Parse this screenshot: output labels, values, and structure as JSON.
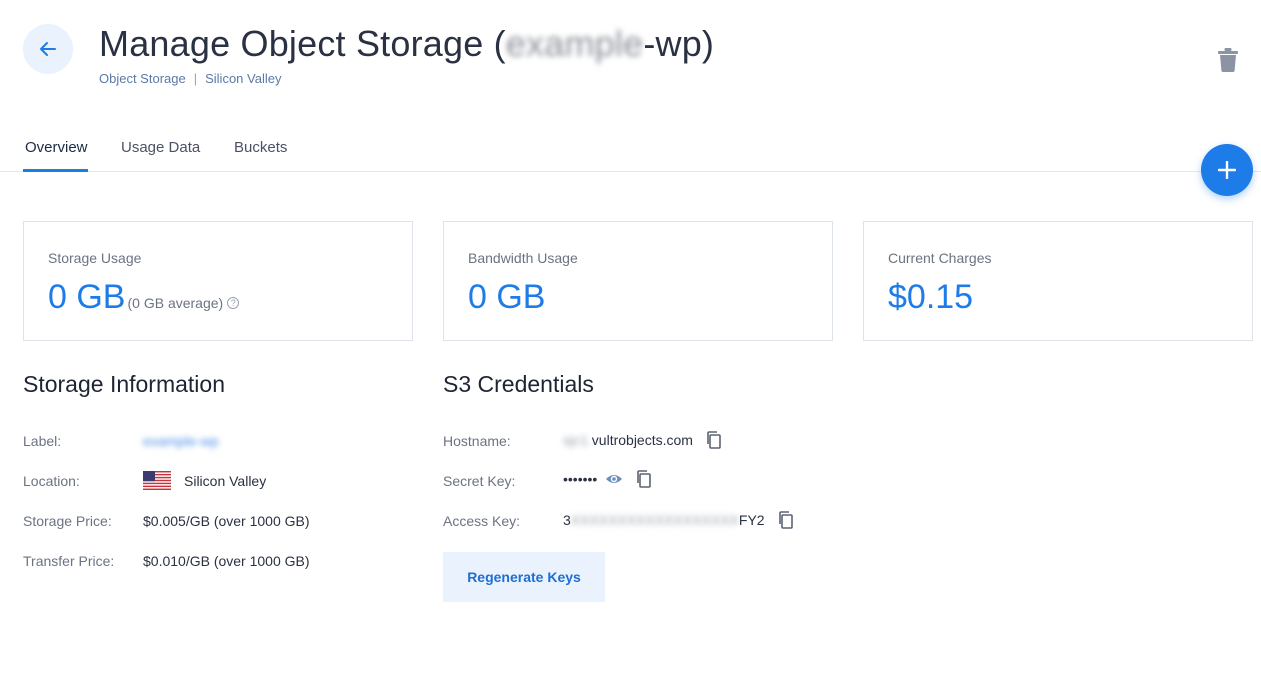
{
  "header": {
    "title_prefix": "Manage Object Storage (",
    "title_redacted": "example",
    "title_suffix": "-wp)",
    "breadcrumb_product": "Object Storage",
    "breadcrumb_separator": "|",
    "breadcrumb_location": "Silicon Valley"
  },
  "tabs": [
    {
      "label": "Overview",
      "active": true
    },
    {
      "label": "Usage Data",
      "active": false
    },
    {
      "label": "Buckets",
      "active": false
    }
  ],
  "cards": [
    {
      "label": "Storage Usage",
      "value": "0 GB",
      "sub": "(0 GB average)"
    },
    {
      "label": "Bandwidth Usage",
      "value": "0 GB"
    },
    {
      "label": "Current Charges",
      "value": "$0.15"
    }
  ],
  "storage_info": {
    "title": "Storage Information",
    "label_key": "Label:",
    "label_value_redacted": "example-wp",
    "location_key": "Location:",
    "location_value": "Silicon Valley",
    "storage_price_key": "Storage Price:",
    "storage_price_value": "$0.005/GB (over 1000 GB)",
    "transfer_price_key": "Transfer Price:",
    "transfer_price_value": "$0.010/GB (over 1000 GB)"
  },
  "s3": {
    "title": "S3 Credentials",
    "hostname_key": "Hostname:",
    "hostname_redacted": "sjc1.",
    "hostname_value": "vultrobjects.com",
    "secret_key_key": "Secret Key:",
    "secret_key_value": "•••••••",
    "access_key_key": "Access Key:",
    "access_key_prefix": "3",
    "access_key_redacted": "XXXXXXXXXXXXXXXXXX",
    "access_key_suffix": "FY2",
    "regenerate_label": "Regenerate Keys"
  },
  "icons": {
    "back": "arrow-left-icon",
    "trash": "trash-icon",
    "add": "plus-icon",
    "copy": "copy-icon",
    "eye": "eye-icon",
    "help": "help-circle-icon",
    "flag": "us-flag-icon"
  },
  "colors": {
    "accent": "#1e7ce8",
    "accent_light": "#eaf2fd"
  }
}
